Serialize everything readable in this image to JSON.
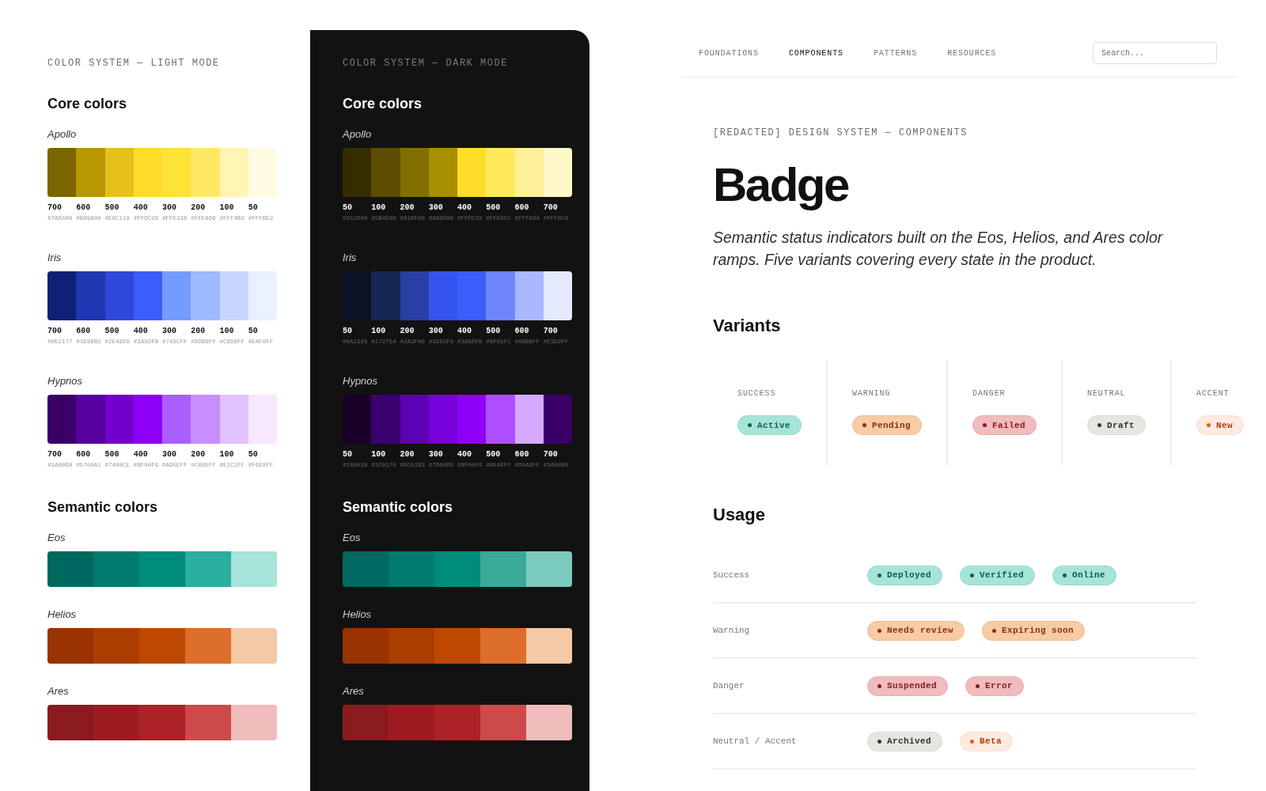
{
  "palettes": [
    {
      "dark": false,
      "eyebrow": "COLOR SYSTEM — LIGHT MODE",
      "core_heading": "Core colors",
      "core_ramps": [
        {
          "name": "Apollo",
          "swatches": [
            {
              "step": "700",
              "hex": "#7A6500",
              "color": "#7a6500"
            },
            {
              "step": "600",
              "hex": "#B89800",
              "color": "#b89800"
            },
            {
              "step": "500",
              "hex": "#E6C119",
              "color": "#e6c119"
            },
            {
              "step": "400",
              "hex": "#FFDC28",
              "color": "#ffdc28"
            },
            {
              "step": "300",
              "hex": "#FFE236",
              "color": "#ffe236"
            },
            {
              "step": "200",
              "hex": "#FFE866",
              "color": "#ffe866"
            },
            {
              "step": "100",
              "hex": "#FFF4B3",
              "color": "#fff4b3"
            },
            {
              "step": "50",
              "hex": "#FFFBE2",
              "color": "#fffbe2"
            }
          ]
        },
        {
          "name": "Iris",
          "swatches": [
            {
              "step": "700",
              "hex": "#0E2177",
              "color": "#0e2177"
            },
            {
              "step": "600",
              "hex": "#1D38B2",
              "color": "#1d38b2"
            },
            {
              "step": "500",
              "hex": "#2E48D9",
              "color": "#2e48d9"
            },
            {
              "step": "400",
              "hex": "#3A5DFB",
              "color": "#3a5dfb"
            },
            {
              "step": "300",
              "hex": "#749CFF",
              "color": "#749cff"
            },
            {
              "step": "200",
              "hex": "#9DB9FF",
              "color": "#9db9ff"
            },
            {
              "step": "100",
              "hex": "#C6D6FF",
              "color": "#c6d6ff"
            },
            {
              "step": "50",
              "hex": "#EAF0FF",
              "color": "#eaf0ff"
            }
          ]
        },
        {
          "name": "Hypnos",
          "swatches": [
            {
              "step": "700",
              "hex": "#3A0068",
              "color": "#3a0068"
            },
            {
              "step": "600",
              "hex": "#5700A1",
              "color": "#5700a1"
            },
            {
              "step": "500",
              "hex": "#7400CE",
              "color": "#7400ce"
            },
            {
              "step": "400",
              "hex": "#8F00F9",
              "color": "#8f00f9"
            },
            {
              "step": "300",
              "hex": "#A95EFF",
              "color": "#a95eff"
            },
            {
              "step": "200",
              "hex": "#C88EFF",
              "color": "#c88eff"
            },
            {
              "step": "100",
              "hex": "#E1C1FF",
              "color": "#e1c1ff"
            },
            {
              "step": "50",
              "hex": "#F6E8FF",
              "color": "#f6e8ff"
            }
          ]
        }
      ],
      "semantic_heading": "Semantic colors",
      "semantic_ramps": [
        {
          "name": "Eos",
          "swatches": [
            {
              "color": "#00695f"
            },
            {
              "color": "#007b6e"
            },
            {
              "color": "#008c7a"
            },
            {
              "color": "#2aae9e"
            },
            {
              "color": "#a6e3d8"
            }
          ]
        },
        {
          "name": "Helios",
          "swatches": [
            {
              "color": "#993300"
            },
            {
              "color": "#ab3d00"
            },
            {
              "color": "#bf4800"
            },
            {
              "color": "#de6e2c"
            },
            {
              "color": "#f5c9a5"
            }
          ]
        },
        {
          "name": "Ares",
          "swatches": [
            {
              "color": "#8b1a1e"
            },
            {
              "color": "#9c1c21"
            },
            {
              "color": "#ad2226"
            },
            {
              "color": "#cc4a4a"
            },
            {
              "color": "#f0bcbc"
            }
          ]
        }
      ]
    },
    {
      "dark": true,
      "eyebrow": "COLOR SYSTEM — DARK MODE",
      "core_heading": "Core colors",
      "core_ramps": [
        {
          "name": "Apollo",
          "swatches": [
            {
              "step": "50",
              "hex": "#352D00",
              "color": "#352d00"
            },
            {
              "step": "100",
              "hex": "#5B4E00",
              "color": "#5b4e00"
            },
            {
              "step": "200",
              "hex": "#816F00",
              "color": "#816f00"
            },
            {
              "step": "300",
              "hex": "#A69000",
              "color": "#a69000"
            },
            {
              "step": "400",
              "hex": "#FFDC28",
              "color": "#ffdc28"
            },
            {
              "step": "500",
              "hex": "#FFE85C",
              "color": "#ffe85c"
            },
            {
              "step": "600",
              "hex": "#FFF09A",
              "color": "#fff09a"
            },
            {
              "step": "700",
              "hex": "#FFF8C8",
              "color": "#fff8c8"
            }
          ]
        },
        {
          "name": "Iris",
          "swatches": [
            {
              "step": "50",
              "hex": "#0A1326",
              "color": "#0a1326"
            },
            {
              "step": "100",
              "hex": "#172754",
              "color": "#172754"
            },
            {
              "step": "200",
              "hex": "#2A3FA6",
              "color": "#2a3fa6"
            },
            {
              "step": "300",
              "hex": "#3655F0",
              "color": "#3655f0"
            },
            {
              "step": "400",
              "hex": "#3A5DFB",
              "color": "#3a5dfb"
            },
            {
              "step": "500",
              "hex": "#6F85FC",
              "color": "#6f85fc"
            },
            {
              "step": "600",
              "hex": "#A9B8FF",
              "color": "#a9b8ff"
            },
            {
              "step": "700",
              "hex": "#E3E9FF",
              "color": "#e3e9ff"
            }
          ]
        },
        {
          "name": "Hypnos",
          "swatches": [
            {
              "step": "50",
              "hex": "#180028",
              "color": "#180028"
            },
            {
              "step": "100",
              "hex": "#3C0170",
              "color": "#3c0170"
            },
            {
              "step": "200",
              "hex": "#5C01B3",
              "color": "#5c01b3"
            },
            {
              "step": "300",
              "hex": "#7600D9",
              "color": "#7600d9"
            },
            {
              "step": "400",
              "hex": "#8F00F9",
              "color": "#8f00f9"
            },
            {
              "step": "500",
              "hex": "#AE4EFF",
              "color": "#ae4eff"
            },
            {
              "step": "600",
              "hex": "#D5A9FF",
              "color": "#d5a9ff"
            },
            {
              "step": "700",
              "hex": "#3A0068",
              "color": "#3a0068"
            }
          ]
        }
      ],
      "semantic_heading": "Semantic colors",
      "semantic_ramps": [
        {
          "name": "Eos",
          "swatches": [
            {
              "color": "#006a60"
            },
            {
              "color": "#007b6e"
            },
            {
              "color": "#008c7a"
            },
            {
              "color": "#3aa999"
            },
            {
              "color": "#7acbbd"
            }
          ]
        },
        {
          "name": "Helios",
          "swatches": [
            {
              "color": "#993300"
            },
            {
              "color": "#ab3d00"
            },
            {
              "color": "#bf4800"
            },
            {
              "color": "#de6e2c"
            },
            {
              "color": "#f5c9a5"
            }
          ]
        },
        {
          "name": "Ares",
          "swatches": [
            {
              "color": "#8b1a1e"
            },
            {
              "color": "#9c1c21"
            },
            {
              "color": "#ad2226"
            },
            {
              "color": "#cc4a4a"
            },
            {
              "color": "#f0bcbc"
            }
          ]
        }
      ]
    }
  ],
  "nav": {
    "tabs": [
      {
        "label": "FOUNDATIONS",
        "selected": false
      },
      {
        "label": "COMPONENTS",
        "selected": true
      },
      {
        "label": "PATTERNS",
        "selected": false
      },
      {
        "label": "RESOURCES",
        "selected": false
      }
    ],
    "search": {
      "placeholder": "Search..."
    }
  },
  "header": {
    "eyebrow": "[REDACTED] DESIGN SYSTEM — COMPONENTS",
    "title": "Badge",
    "description": "Semantic status indicators built on the Eos, Helios, and Ares color ramps. Five variants covering every state in the product."
  },
  "variants": {
    "heading": "Variants",
    "items": [
      {
        "kind": "success",
        "label": "SUCCESS",
        "badge": "Active"
      },
      {
        "kind": "warning",
        "label": "WARNING",
        "badge": "Pending"
      },
      {
        "kind": "danger",
        "label": "DANGER",
        "badge": "Failed"
      },
      {
        "kind": "neutral",
        "label": "NEUTRAL",
        "badge": "Draft"
      },
      {
        "kind": "accent",
        "label": "ACCENT",
        "badge": "New"
      }
    ]
  },
  "usage": {
    "heading": "Usage",
    "rows": [
      {
        "label": "Success",
        "badges": [
          {
            "kind": "success",
            "text": "Deployed"
          },
          {
            "kind": "success",
            "text": "Verified"
          },
          {
            "kind": "success",
            "text": "Online"
          }
        ]
      },
      {
        "label": "Warning",
        "badges": [
          {
            "kind": "warning",
            "text": "Needs review"
          },
          {
            "kind": "warning",
            "text": "Expiring soon"
          }
        ]
      },
      {
        "label": "Danger",
        "badges": [
          {
            "kind": "danger",
            "text": "Suspended"
          },
          {
            "kind": "danger",
            "text": "Error"
          }
        ]
      },
      {
        "label": "Neutral / Accent",
        "badges": [
          {
            "kind": "neutral",
            "text": "Archived"
          },
          {
            "kind": "accent",
            "text": "Beta"
          }
        ]
      }
    ]
  }
}
